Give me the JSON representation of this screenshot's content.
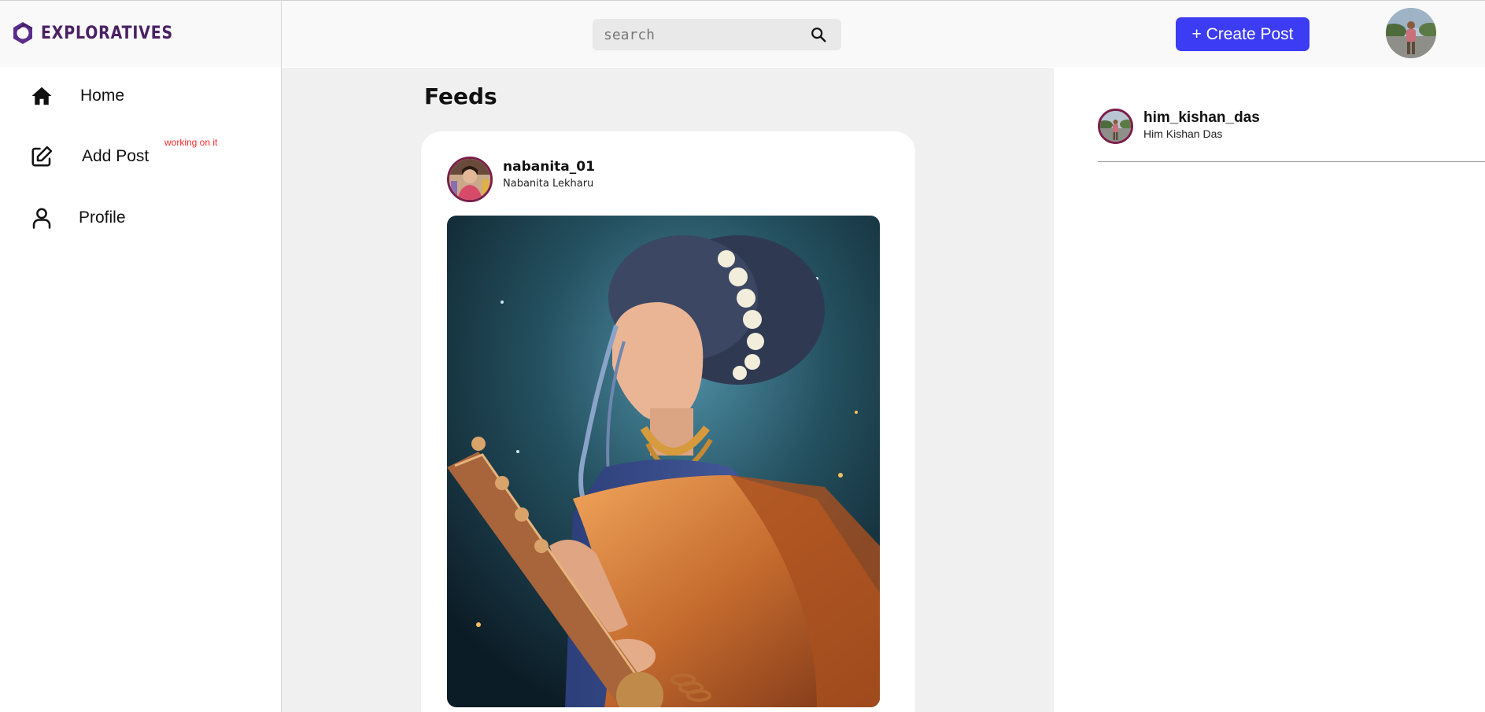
{
  "brand": {
    "name": "EXPLORATIVES",
    "color": "#4a2063"
  },
  "header": {
    "search": {
      "placeholder": "search",
      "value": ""
    },
    "create_post_label": "+ Create Post",
    "accent": "#3c3cf5"
  },
  "sidebar": {
    "items": [
      {
        "label": "Home",
        "icon": "home-icon"
      },
      {
        "label": "Add Post",
        "icon": "edit-icon",
        "note": "working on it"
      },
      {
        "label": "Profile",
        "icon": "person-icon"
      }
    ]
  },
  "feed": {
    "title": "Feeds",
    "posts": [
      {
        "username": "nabanita_01",
        "full_name": "Nabanita Lekharu"
      }
    ]
  },
  "right_panel": {
    "current_user": {
      "username": "him_kishan_das",
      "full_name": "Him Kishan Das"
    }
  }
}
